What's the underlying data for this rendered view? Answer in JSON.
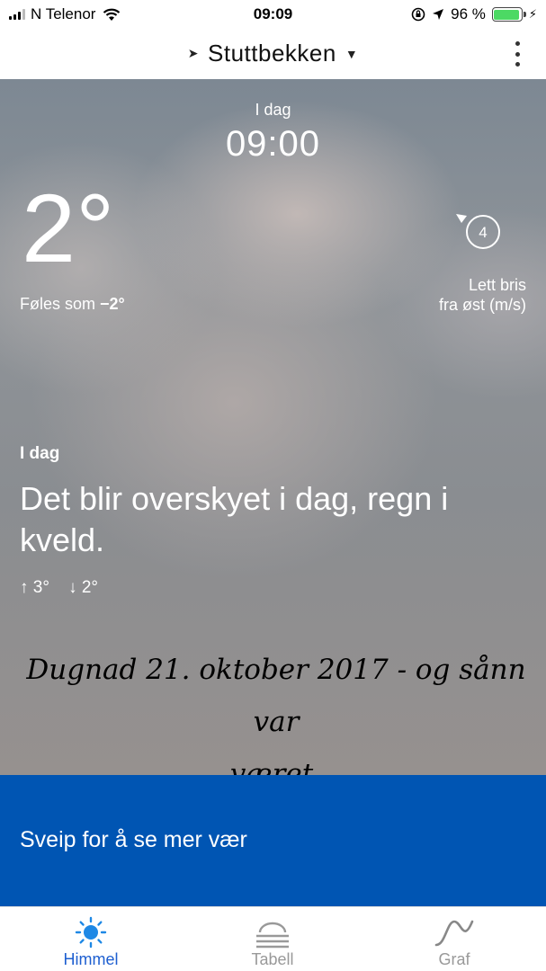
{
  "status_bar": {
    "carrier": "N Telenor",
    "time": "09:09",
    "battery_percent": "96 %",
    "battery_level": 0.96,
    "battery_color": "#4cd964"
  },
  "header": {
    "location": "Stuttbekken",
    "location_icon": "location-arrow-icon",
    "caret_icon": "chevron-down-icon",
    "menu_icon": "more-vertical-icon"
  },
  "current": {
    "day": "I dag",
    "time": "09:00",
    "temperature": "2°",
    "feels_like_label": "Føles som",
    "feels_like_value": "−2°",
    "wind_speed": "4",
    "wind_line1": "Lett bris",
    "wind_line2": "fra øst (m/s)"
  },
  "forecast": {
    "label": "I dag",
    "text": "Det blir overskyet i dag, regn i kveld.",
    "high": "↑ 3°",
    "low": "↓ 2°"
  },
  "handwritten_note": {
    "line1": "Dugnad 21. oktober 2017 - og sånn var",
    "line2": "været."
  },
  "swipe_banner": {
    "text": "Sveip for å se mer vær",
    "color": "#0055b3"
  },
  "tabs": [
    {
      "label": "Himmel",
      "icon": "sun-icon",
      "active": true
    },
    {
      "label": "Tabell",
      "icon": "cloud-lines-icon",
      "active": false
    },
    {
      "label": "Graf",
      "icon": "graph-wave-icon",
      "active": false
    }
  ],
  "accent_color": "#1e5fd0"
}
